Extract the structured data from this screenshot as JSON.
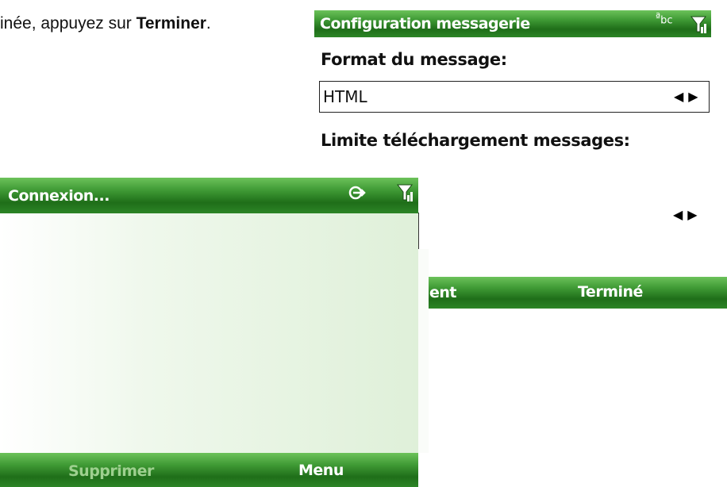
{
  "document": {
    "instruction_prefix": "inée, appuyez sur ",
    "instruction_bold": "Terminer",
    "instruction_suffix": "."
  },
  "config_screen": {
    "title": "Configuration messagerie",
    "format_label": "Format du message:",
    "format_value": "HTML",
    "limit_label": "Limite téléchargement messages:",
    "softkey_left_partial": "ent",
    "softkey_right": "Terminé",
    "status_icons": [
      "abc-input-icon",
      "signal-icon"
    ]
  },
  "connection_screen": {
    "title": "Connexion...",
    "softkey_left": "Supprimer",
    "softkey_right": "Menu",
    "status_icons": [
      "connection-icon",
      "signal-icon"
    ]
  },
  "colors": {
    "bar_green": "#3f9a35",
    "body_green": "#dff0d9",
    "disabled_softkey": "#9ed08f"
  }
}
